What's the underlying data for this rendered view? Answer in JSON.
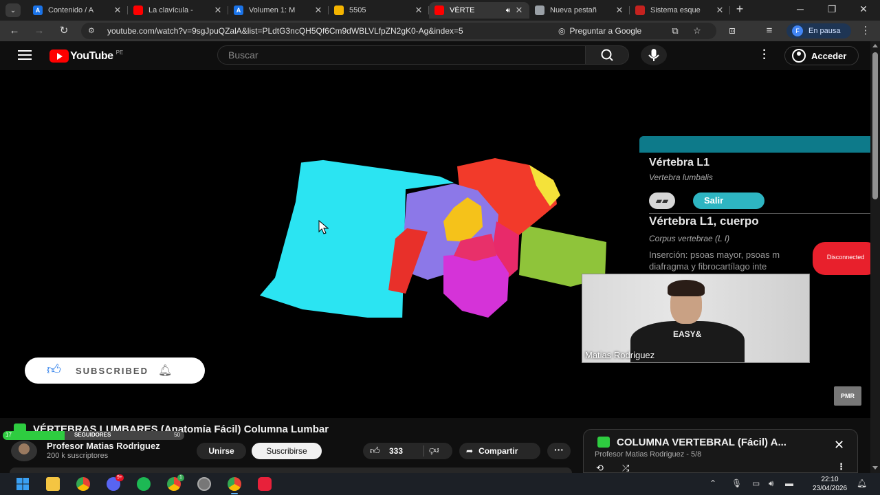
{
  "browser": {
    "tabs": [
      {
        "label": "Contenido / A",
        "favicon": "A",
        "favicon_color": "#1a73e8",
        "active": false
      },
      {
        "label": "La clavícula -",
        "favicon": "",
        "favicon_color": "#ff0000",
        "active": false
      },
      {
        "label": "Volumen 1: M",
        "favicon": "A",
        "favicon_color": "#1a73e8",
        "active": false
      },
      {
        "label": "5505",
        "favicon": "",
        "favicon_color": "#f4b400",
        "active": false
      },
      {
        "label": "VÉRTE",
        "favicon": "",
        "favicon_color": "#ff0000",
        "active": true
      },
      {
        "label": "Nueva pestañ",
        "favicon": "",
        "favicon_color": "#9aa0a6",
        "active": false
      },
      {
        "label": "Sistema esque",
        "favicon": "",
        "favicon_color": "#c5221f",
        "active": false
      }
    ],
    "url": "youtube.com/watch?v=9sgJpuQZalA&list=PLdtG3ncQH5Qf6Cm9dWBLVLfpZN2gK0-Ag&index=5",
    "ask_google": "Preguntar a Google",
    "profile_status": "En pausa",
    "profile_initial": "F"
  },
  "youtube": {
    "logo_text": "YouTube",
    "region": "PE",
    "search_placeholder": "Buscar",
    "signin_label": "Acceder"
  },
  "player": {
    "info_title": "Vértebra L1",
    "info_latin": "Vertebra lumbalis",
    "exit_label": "Salir",
    "part_title": "Vértebra L1, cuerpo",
    "part_latin": "Corpus vertebrae (L I)",
    "insertion_line1": "Inserción: psoas mayor, psoas m",
    "insertion_line2": "diafragma y fibrocartílago inte",
    "webcam_name": "Matias Rodriguez",
    "webcam_shirt": "EASY&",
    "disconnected_label": "Disconnected",
    "subscribed_label": "SUBSCRIBED",
    "badge_label": "PMR"
  },
  "video": {
    "title": "VÉRTEBRAS LUMBARES (Anatomía Fácil) Columna Lumbar",
    "followers_left": "17",
    "followers_label": "SEGUIDORES",
    "followers_right": "50",
    "followers_progress": 0.34,
    "channel_name": "Profesor Matias Rodriguez",
    "channel_subs": "200 k suscriptores",
    "join_label": "Unirse",
    "subscribe_label": "Suscribirse",
    "like_count": "333",
    "share_label": "Compartir"
  },
  "playlist": {
    "title": "COLUMNA VERTEBRAL (Fácil) A...",
    "subtitle": "Profesor Matias Rodriguez - 5/8"
  },
  "taskbar": {
    "discord_badge": "9+",
    "chrome2_badge": "1",
    "time": "22:10",
    "date": "23/04/2026"
  }
}
